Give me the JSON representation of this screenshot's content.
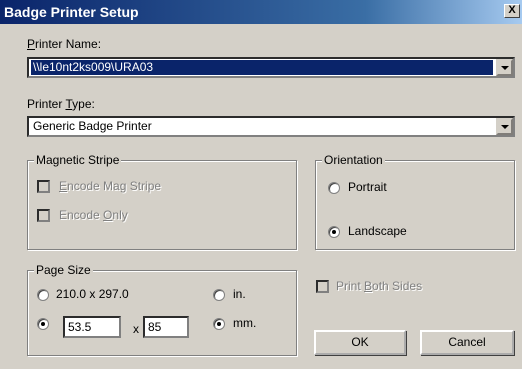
{
  "window": {
    "title": "Badge Printer Setup",
    "close_glyph": "X"
  },
  "printer_name": {
    "label_accel": "P",
    "label_rest": "rinter Name:",
    "value": "\\\\le10nt2ks009\\URA03"
  },
  "printer_type": {
    "label_pre": "Printer ",
    "label_accel": "T",
    "label_rest": "ype:",
    "value": "Generic Badge Printer"
  },
  "magnetic_stripe": {
    "legend": "Magnetic Stripe",
    "encode_mag_accel": "E",
    "encode_mag_rest": "ncode Mag Stripe",
    "encode_only_pre": "Encode ",
    "encode_only_accel": "O",
    "encode_only_rest": "nly"
  },
  "orientation": {
    "legend": "Orientation",
    "portrait": "Portrait",
    "landscape": "Landscape",
    "selected": "Landscape"
  },
  "page_size": {
    "legend": "Page Size",
    "preset_label": "210.0 x 297.0",
    "custom_width": "53.5",
    "times": "x",
    "custom_height": "85",
    "unit_in": "in.",
    "unit_mm": "mm.",
    "selected_size": "custom",
    "selected_unit": "mm."
  },
  "print_both_sides": {
    "pre": "Print ",
    "accel": "B",
    "rest": "oth Sides"
  },
  "buttons": {
    "ok": "OK",
    "cancel": "Cancel"
  }
}
